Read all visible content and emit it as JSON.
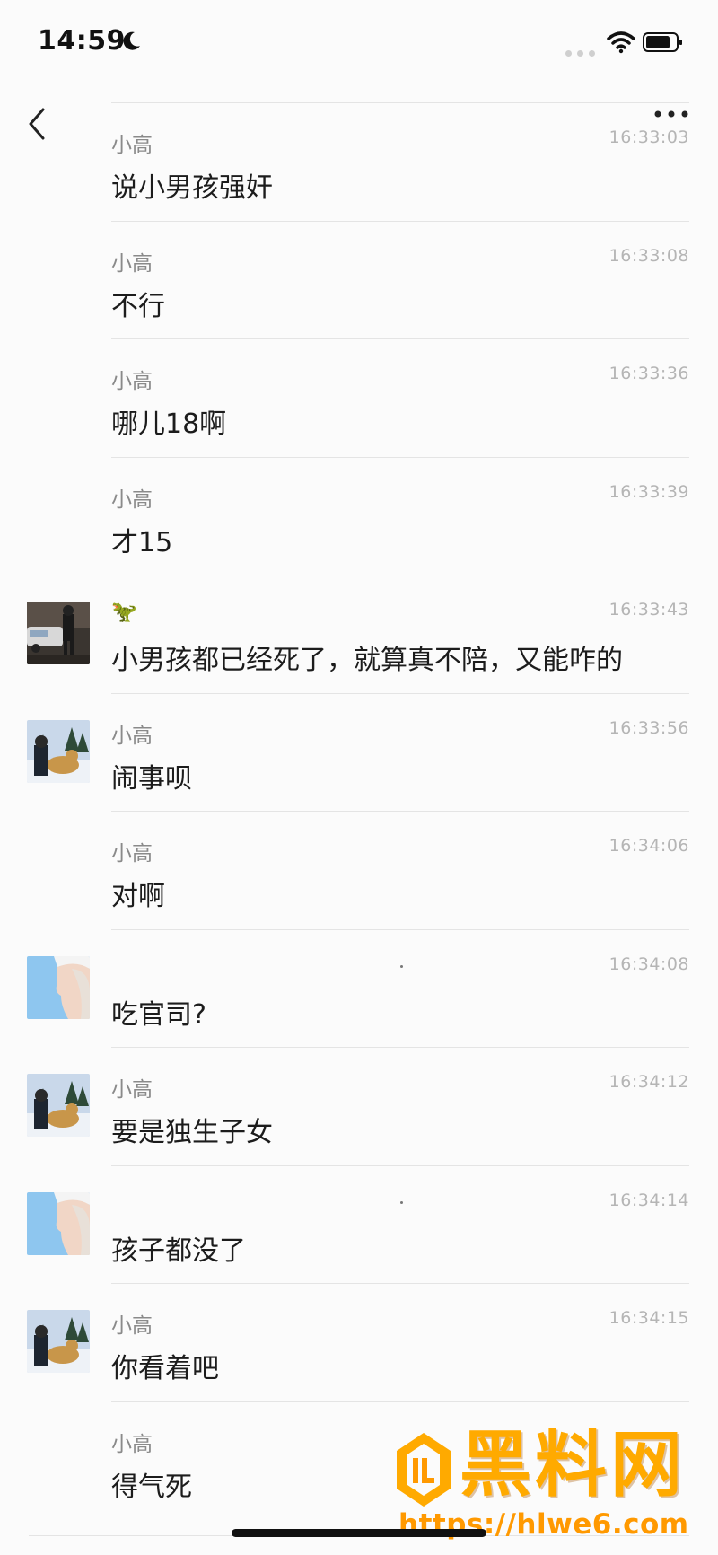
{
  "status_bar": {
    "time": "14:59"
  },
  "messages": [
    {
      "name": "小高",
      "time": "16:33:03",
      "text": "说小男孩强奸",
      "avatar": ""
    },
    {
      "name": "小高",
      "time": "16:33:08",
      "text": "不行",
      "avatar": ""
    },
    {
      "name": "小高",
      "time": "16:33:36",
      "text": "哪儿18啊",
      "avatar": ""
    },
    {
      "name": "小高",
      "time": "16:33:39",
      "text": "才15",
      "avatar": ""
    },
    {
      "name": "🦖",
      "time": "16:33:43",
      "text": "小男孩都已经死了，就算真不陪，又能咋的",
      "avatar": "car-photo-avatar"
    },
    {
      "name": "小高",
      "time": "16:33:56",
      "text": "闹事呗",
      "avatar": "dog-snow-avatar"
    },
    {
      "name": "小高",
      "time": "16:34:06",
      "text": "对啊",
      "avatar": ""
    },
    {
      "name": "",
      "time": "16:34:08",
      "text": "吃官司?",
      "avatar": "profile-girl-avatar"
    },
    {
      "name": "小高",
      "time": "16:34:12",
      "text": "要是独生子女",
      "avatar": "dog-snow-avatar"
    },
    {
      "name": "",
      "time": "16:34:14",
      "text": "孩子都没了",
      "avatar": "profile-girl-avatar"
    },
    {
      "name": "小高",
      "time": "16:34:15",
      "text": "你看着吧",
      "avatar": "dog-snow-avatar"
    },
    {
      "name": "小高",
      "time": "",
      "text": "得气死",
      "avatar": ""
    }
  ],
  "watermark": {
    "title": "黑料网",
    "url": "https://hlwe6.com"
  },
  "colors": {
    "background": "#fbfbfb",
    "separator": "#e4e4e4",
    "watermark": "#ffaa00"
  }
}
